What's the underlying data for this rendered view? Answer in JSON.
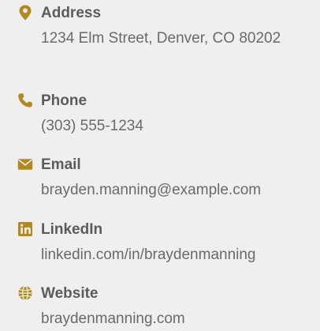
{
  "accent_color": "#b08a1e",
  "contacts": {
    "address": {
      "label": "Address",
      "value": "1234 Elm Street, Denver, CO 80202",
      "icon": "map-marker-icon"
    },
    "phone": {
      "label": "Phone",
      "value": "(303) 555-1234",
      "icon": "phone-icon"
    },
    "email": {
      "label": "Email",
      "value": "brayden.manning@example.com",
      "icon": "envelope-icon"
    },
    "linkedin": {
      "label": "LinkedIn",
      "value": "linkedin.com/in/braydenmanning",
      "icon": "linkedin-icon"
    },
    "website": {
      "label": "Website",
      "value": "braydenmanning.com",
      "icon": "globe-icon"
    }
  }
}
